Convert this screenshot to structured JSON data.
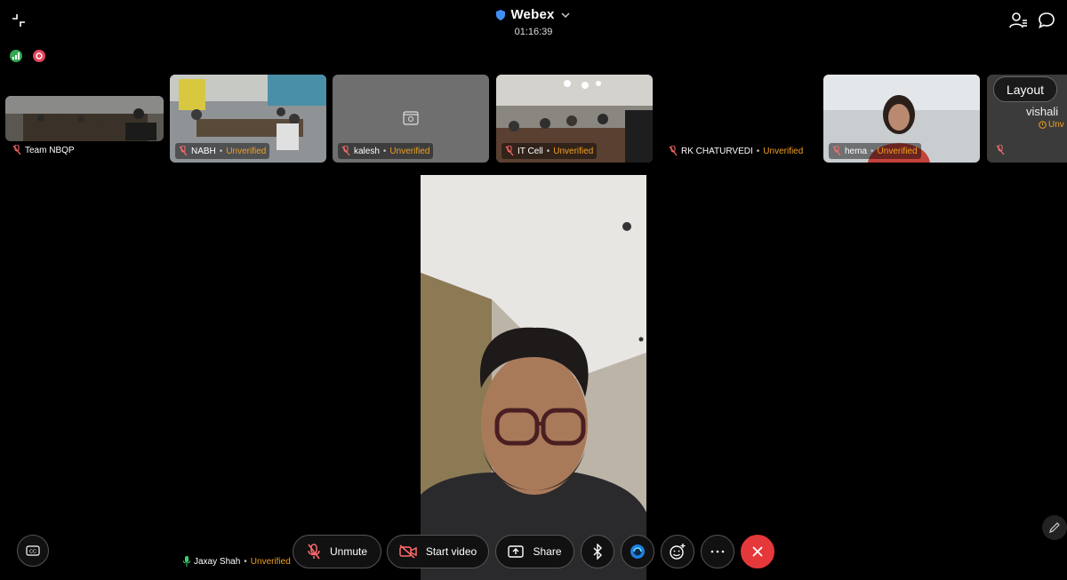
{
  "app": {
    "title": "Webex",
    "timer": "01:16:39"
  },
  "colors": {
    "unverified": "#f0a020",
    "end_call": "#e5383b",
    "signal": "#2fa84f",
    "recording": "#e8435a"
  },
  "thumbnails": [
    {
      "name": "Team NBQP",
      "status": ""
    },
    {
      "name": "NABH",
      "status": "Unverified"
    },
    {
      "name": "kalesh",
      "status": "Unverified"
    },
    {
      "name": "IT Cell",
      "status": "Unverified"
    },
    {
      "name": "RK CHATURVEDI",
      "status": "Unverified"
    },
    {
      "name": "hema",
      "status": "Unverified"
    },
    {
      "name": "vishali",
      "status": "Unv"
    }
  ],
  "layout_button": "Layout",
  "self_view": {
    "name": "Jaxay Shah",
    "status": "Unverified"
  },
  "controls": {
    "unmute": "Unmute",
    "start_video": "Start video",
    "share": "Share"
  },
  "icons": {
    "collapse": "collapse-icon",
    "participants": "participants-icon",
    "chat": "chat-icon",
    "bluetooth": "bluetooth-icon",
    "webex_assistant": "assistant-icon",
    "reactions": "reactions-icon",
    "more": "more-icon",
    "end": "end-call-icon",
    "captions": "closed-captions-icon",
    "annotate": "pen-icon"
  }
}
